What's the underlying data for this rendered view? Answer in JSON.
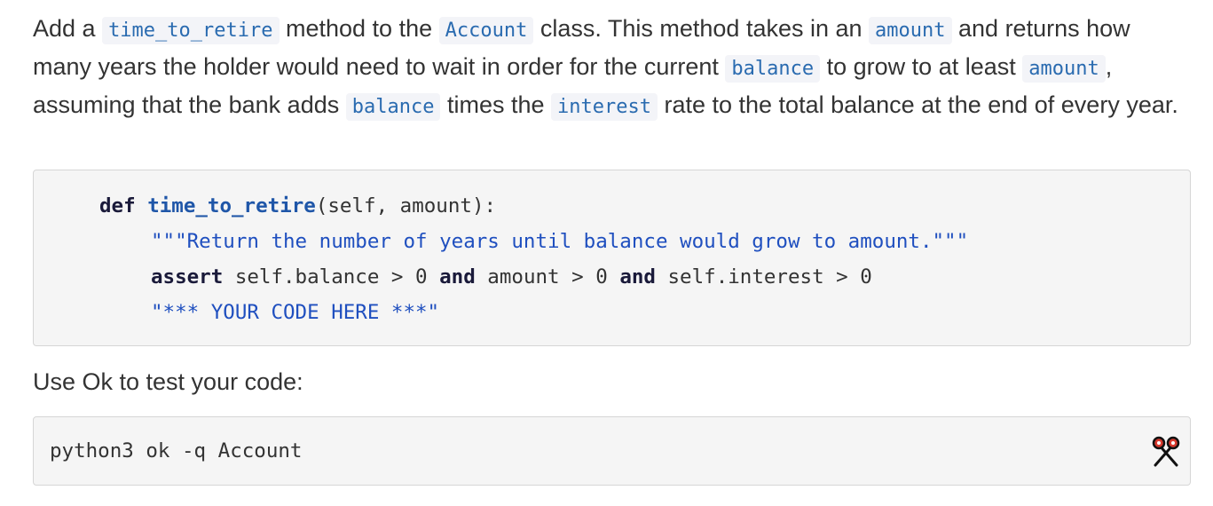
{
  "intro": {
    "t1": "Add a ",
    "c1": "time_to_retire",
    "t2": " method to the ",
    "c2": "Account",
    "t3": " class. This method takes in an ",
    "c3": "amount",
    "t4": " and returns how many years the holder would need to wait in order for the current ",
    "c4": "balance",
    "t5": " to grow to at least ",
    "c5": "amount",
    "t6": ", assuming that the bank adds ",
    "c6": "balance",
    "t7": " times the ",
    "c7": "interest",
    "t8": " rate to the total balance at the end of every year."
  },
  "code": {
    "l1_kw": "def",
    "l1_fn": "time_to_retire",
    "l1_rest": "(self, amount):",
    "l2": "\"\"\"Return the number of years until balance would grow to amount.\"\"\"",
    "l3_kw1": "assert",
    "l3_mid1": " self.balance > 0 ",
    "l3_kw2": "and",
    "l3_mid2": " amount > 0 ",
    "l3_kw3": "and",
    "l3_end": " self.interest > 0",
    "l4": "\"*** YOUR CODE HERE ***\""
  },
  "ok_label": "Use Ok to test your code:",
  "command": "python3 ok -q Account",
  "icons": {
    "copy": "scissors-icon"
  },
  "colors": {
    "inline_code": "#2a6bb0",
    "string": "#1f4fbf",
    "function": "#1f56a8"
  }
}
